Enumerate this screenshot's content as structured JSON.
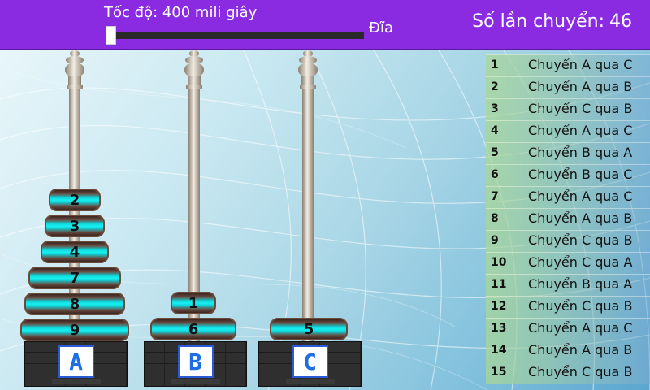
{
  "header": {
    "speed_label": "Tốc độ: 400 mili giây",
    "speed_value_ms": 400,
    "disc_label": "Đĩa",
    "moves_label": "Số lần chuyển:",
    "moves_count": "46"
  },
  "pegs": [
    {
      "label": "A",
      "disks": [
        "2",
        "3",
        "4",
        "7",
        "8",
        "9"
      ]
    },
    {
      "label": "B",
      "disks": [
        "1",
        "6"
      ]
    },
    {
      "label": "C",
      "disks": [
        "5"
      ]
    }
  ],
  "log": [
    {
      "n": "1",
      "text": "Chuyển A qua C"
    },
    {
      "n": "2",
      "text": "Chuyển A qua B"
    },
    {
      "n": "3",
      "text": "Chuyển C qua B"
    },
    {
      "n": "4",
      "text": "Chuyển A qua C"
    },
    {
      "n": "5",
      "text": "Chuyển B qua A"
    },
    {
      "n": "6",
      "text": "Chuyển B qua C"
    },
    {
      "n": "7",
      "text": "Chuyển A qua C"
    },
    {
      "n": "8",
      "text": "Chuyển A qua B"
    },
    {
      "n": "9",
      "text": "Chuyển C qua B"
    },
    {
      "n": "10",
      "text": "Chuyển C qua A"
    },
    {
      "n": "11",
      "text": "Chuyển B qua A"
    },
    {
      "n": "12",
      "text": "Chuyển C qua B"
    },
    {
      "n": "13",
      "text": "Chuyển A qua C"
    },
    {
      "n": "14",
      "text": "Chuyển A qua B"
    },
    {
      "n": "15",
      "text": "Chuyển C qua B"
    }
  ]
}
